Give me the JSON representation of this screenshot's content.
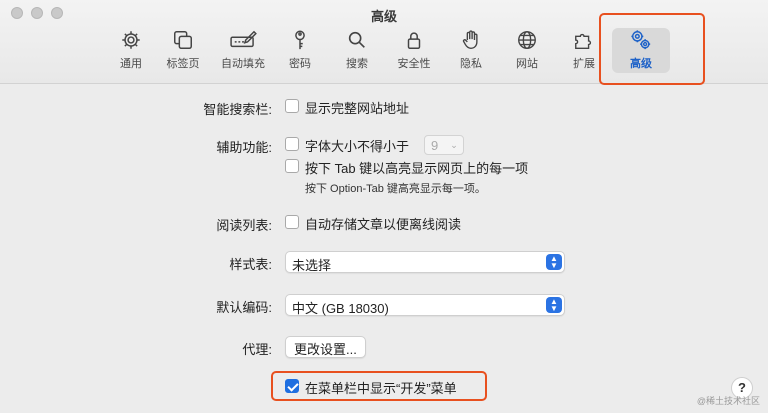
{
  "window": {
    "title": "高级"
  },
  "tabs": [
    {
      "label": "通用",
      "icon": "gear-icon"
    },
    {
      "label": "标签页",
      "icon": "tabs-icon"
    },
    {
      "label": "自动填充",
      "icon": "pencil-field-icon"
    },
    {
      "label": "密码",
      "icon": "key-icon"
    },
    {
      "label": "搜索",
      "icon": "search-icon"
    },
    {
      "label": "安全性",
      "icon": "lock-icon"
    },
    {
      "label": "隐私",
      "icon": "hand-icon"
    },
    {
      "label": "网站",
      "icon": "globe-icon"
    },
    {
      "label": "扩展",
      "icon": "puzzle-icon"
    },
    {
      "label": "高级",
      "icon": "gears-icon",
      "active": true
    }
  ],
  "settings": {
    "smart_search": {
      "label": "智能搜索栏:",
      "option": "显示完整网站地址",
      "checked": false
    },
    "accessibility": {
      "label": "辅助功能:",
      "font_option": "字体大小不得小于",
      "font_size": "9",
      "tab_option": "按下 Tab 键以高亮显示网页上的每一项",
      "tab_hint": "按下 Option-Tab 键高亮显示每一项。"
    },
    "reading_list": {
      "label": "阅读列表:",
      "option": "自动存储文章以便离线阅读",
      "checked": false
    },
    "stylesheet": {
      "label": "样式表:",
      "value": "未选择"
    },
    "encoding": {
      "label": "默认编码:",
      "value": "中文 (GB 18030)"
    },
    "proxy": {
      "label": "代理:",
      "button": "更改设置..."
    },
    "develop_menu": {
      "option": "在菜单栏中显示“开发”菜单",
      "checked": true
    }
  },
  "help": "?",
  "watermark": "@稀土技术社区",
  "colors": {
    "highlight": "#e8501f",
    "accent": "#1f6fe0"
  }
}
